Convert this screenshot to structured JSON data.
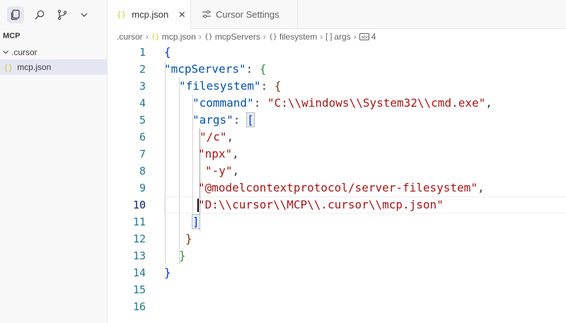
{
  "sidebar": {
    "title": "MCP",
    "folder": ".cursor",
    "file_icon": "{}",
    "file": "mcp.json"
  },
  "tabs": [
    {
      "icon": "{}",
      "label": "mcp.json",
      "close": "×"
    },
    {
      "label": "Cursor Settings"
    }
  ],
  "breadcrumb": {
    "folder": ".cursor",
    "file": "mcp.json",
    "obj1": "mcpServers",
    "obj2": "filesystem",
    "arr": "args",
    "num": "4",
    "obj_icon": "{}",
    "arr_icon": "[ ]"
  },
  "editor": {
    "line_numbers": [
      "1",
      "2",
      "3",
      "4",
      "5",
      "6",
      "7",
      "8",
      "9",
      "10",
      "11",
      "12",
      "13",
      "14",
      "15",
      "16"
    ],
    "current_line": "10",
    "lines": {
      "l1_brace": "{",
      "l2_key": "\"mcpServers\"",
      "l2_rest": ": ",
      "l2_brace": "{",
      "l3_key": "\"filesystem\"",
      "l3_rest": ": ",
      "l3_brace": "{",
      "l4_key": "\"command\"",
      "l4_colon": ": ",
      "l4_val": "\"C:\\\\windows\\\\System32\\\\cmd.exe\"",
      "l4_comma": ",",
      "l5_key": "\"args\"",
      "l5_colon": ": ",
      "l5_bracket": "[",
      "l6_val": "\"/c\"",
      "l6_comma": ",",
      "l7_val": "\"npx\"",
      "l7_comma": ",",
      "l8_val": "\"-y\"",
      "l8_comma": ",",
      "l9_val": "\"@modelcontextprotocol/server-filesystem\"",
      "l9_comma": ",",
      "l10_val": "\"D:\\\\cursor\\\\MCP\\\\.cursor\\\\mcp.json\"",
      "l11_bracket": "]",
      "l12_brace": "}",
      "l13_brace": "}",
      "l14_brace": "}"
    }
  },
  "colors": {
    "key": "#0451a5",
    "string": "#a31515",
    "bracket_level1": "#0431fa",
    "bracket_level2": "#319331",
    "bracket_level3": "#7b3814",
    "line_number": "#237893"
  }
}
